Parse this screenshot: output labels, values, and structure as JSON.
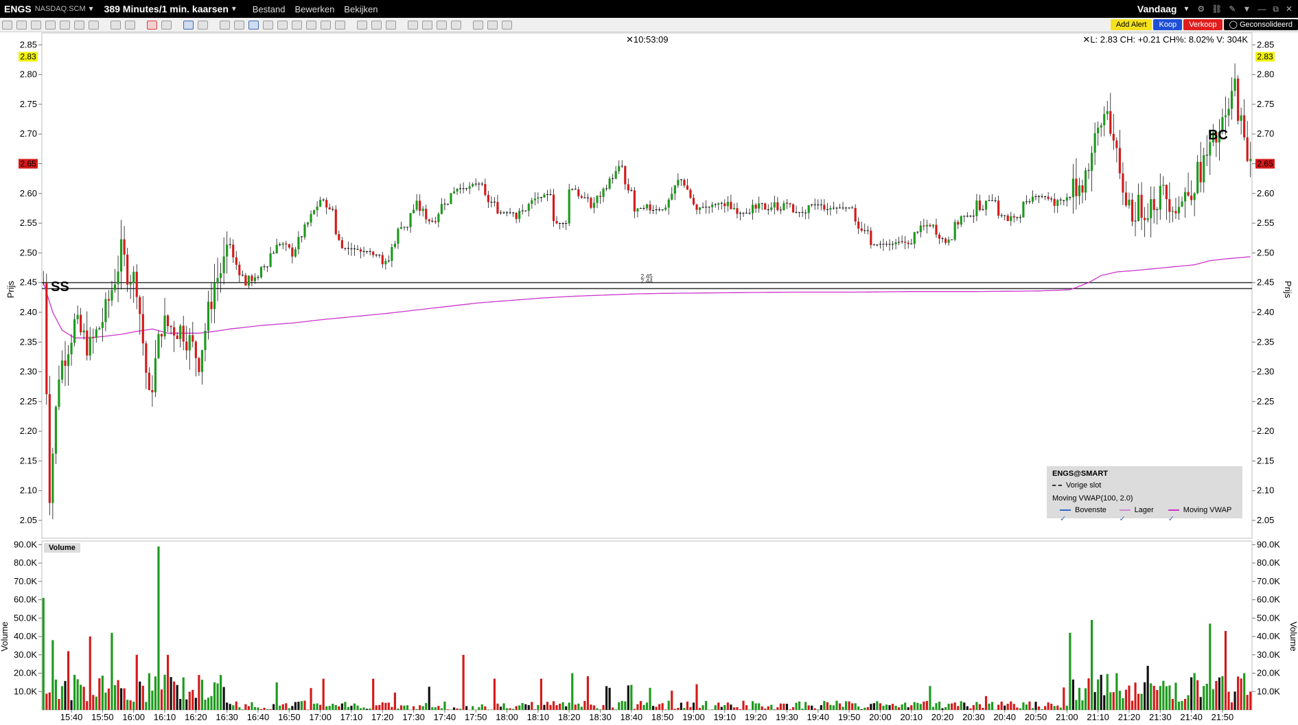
{
  "window": {
    "symbol": "ENGS",
    "exchange": "NASDAQ.SCM",
    "period": "389 Minutes/1 min. kaarsen",
    "menus": [
      "Bestand",
      "Bewerken",
      "Bekijken"
    ],
    "range": "Vandaag"
  },
  "actions": {
    "alert": "Add Alert",
    "buy": "Koop",
    "sell": "Verkoop",
    "consolidated": "Geconsolideerd"
  },
  "header": {
    "time": "10:53:09",
    "quote": "L: 2.83 CH: +0.21 CH%: 8.02% V: 304K"
  },
  "colors": {
    "up": "#1e9a1e",
    "down": "#d41a1a",
    "vwap": "#cc33cc",
    "last_tag": "#f2f20a",
    "price_tag": "#d41a1a"
  },
  "price_tags": {
    "last": "2.83",
    "current": "2.65"
  },
  "markers": {
    "ss": "SS",
    "bc": "BC"
  },
  "hlines": {
    "upper": "2.45",
    "lower": "2.44"
  },
  "legend": {
    "title": "ENGS@SMART",
    "prev_close": "Vorige slot",
    "indicator": "Moving VWAP(100, 2.0)",
    "items": [
      "Bovenste",
      "Lager",
      "Moving VWAP"
    ]
  },
  "volume_label": "Volume",
  "chart_data": {
    "type": "candlestick",
    "price_axis": {
      "label": "Prijs",
      "range": [
        2.02,
        2.87
      ],
      "ticks": [
        "2.05",
        "2.10",
        "2.15",
        "2.20",
        "2.25",
        "2.30",
        "2.35",
        "2.40",
        "2.45",
        "2.50",
        "2.55",
        "2.60",
        "2.65",
        "2.70",
        "2.75",
        "2.80",
        "2.85"
      ]
    },
    "volume_axis": {
      "label": "Volume",
      "range": [
        0,
        92000
      ],
      "ticks": [
        "10.0K",
        "20.0K",
        "30.0K",
        "40.0K",
        "50.0K",
        "60.0K",
        "70.0K",
        "80.0K",
        "90.0K"
      ]
    },
    "time_ticks": [
      "15:40",
      "15:50",
      "16:00",
      "16:10",
      "16:20",
      "16:30",
      "16:40",
      "16:50",
      "17:00",
      "17:10",
      "17:20",
      "17:30",
      "17:40",
      "17:50",
      "18:00",
      "18:10",
      "18:20",
      "18:30",
      "18:40",
      "18:50",
      "19:00",
      "19:10",
      "19:20",
      "19:30",
      "19:40",
      "19:50",
      "20:00",
      "20:10",
      "20:20",
      "20:30",
      "20:40",
      "20:50",
      "21:00",
      "21:10",
      "21:20",
      "21:30",
      "21:40",
      "21:50"
    ],
    "path": [
      {
        "m": 0,
        "p": 2.45
      },
      {
        "m": 2,
        "p": 2.1
      },
      {
        "m": 5,
        "p": 2.3
      },
      {
        "m": 10,
        "p": 2.38
      },
      {
        "m": 15,
        "p": 2.34
      },
      {
        "m": 20,
        "p": 2.4
      },
      {
        "m": 25,
        "p": 2.5
      },
      {
        "m": 27,
        "p": 2.47
      },
      {
        "m": 30,
        "p": 2.45
      },
      {
        "m": 34,
        "p": 2.25
      },
      {
        "m": 38,
        "p": 2.38
      },
      {
        "m": 45,
        "p": 2.37
      },
      {
        "m": 50,
        "p": 2.32
      },
      {
        "m": 55,
        "p": 2.45
      },
      {
        "m": 60,
        "p": 2.5
      },
      {
        "m": 65,
        "p": 2.45
      },
      {
        "m": 70,
        "p": 2.47
      },
      {
        "m": 75,
        "p": 2.52
      },
      {
        "m": 80,
        "p": 2.5
      },
      {
        "m": 85,
        "p": 2.55
      },
      {
        "m": 90,
        "p": 2.6
      },
      {
        "m": 95,
        "p": 2.52
      },
      {
        "m": 100,
        "p": 2.5
      },
      {
        "m": 105,
        "p": 2.5
      },
      {
        "m": 110,
        "p": 2.48
      },
      {
        "m": 115,
        "p": 2.55
      },
      {
        "m": 120,
        "p": 2.58
      },
      {
        "m": 125,
        "p": 2.55
      },
      {
        "m": 130,
        "p": 2.6
      },
      {
        "m": 135,
        "p": 2.62
      },
      {
        "m": 140,
        "p": 2.6
      },
      {
        "m": 145,
        "p": 2.58
      },
      {
        "m": 150,
        "p": 2.55
      },
      {
        "m": 160,
        "p": 2.6
      },
      {
        "m": 165,
        "p": 2.55
      },
      {
        "m": 170,
        "p": 2.62
      },
      {
        "m": 175,
        "p": 2.57
      },
      {
        "m": 185,
        "p": 2.64
      },
      {
        "m": 190,
        "p": 2.57
      },
      {
        "m": 200,
        "p": 2.58
      },
      {
        "m": 205,
        "p": 2.63
      },
      {
        "m": 210,
        "p": 2.57
      },
      {
        "m": 220,
        "p": 2.58
      },
      {
        "m": 225,
        "p": 2.57
      },
      {
        "m": 235,
        "p": 2.58
      },
      {
        "m": 245,
        "p": 2.57
      },
      {
        "m": 250,
        "p": 2.58
      },
      {
        "m": 260,
        "p": 2.57
      },
      {
        "m": 265,
        "p": 2.51
      },
      {
        "m": 275,
        "p": 2.51
      },
      {
        "m": 280,
        "p": 2.53
      },
      {
        "m": 285,
        "p": 2.55
      },
      {
        "m": 290,
        "p": 2.52
      },
      {
        "m": 295,
        "p": 2.56
      },
      {
        "m": 300,
        "p": 2.58
      },
      {
        "m": 305,
        "p": 2.58
      },
      {
        "m": 310,
        "p": 2.55
      },
      {
        "m": 315,
        "p": 2.58
      },
      {
        "m": 320,
        "p": 2.6
      },
      {
        "m": 325,
        "p": 2.58
      },
      {
        "m": 330,
        "p": 2.6
      },
      {
        "m": 334,
        "p": 2.62
      },
      {
        "m": 338,
        "p": 2.68
      },
      {
        "m": 342,
        "p": 2.75
      },
      {
        "m": 346,
        "p": 2.62
      },
      {
        "m": 350,
        "p": 2.57
      },
      {
        "m": 355,
        "p": 2.58
      },
      {
        "m": 360,
        "p": 2.6
      },
      {
        "m": 365,
        "p": 2.58
      },
      {
        "m": 370,
        "p": 2.62
      },
      {
        "m": 375,
        "p": 2.67
      },
      {
        "m": 380,
        "p": 2.72
      },
      {
        "m": 383,
        "p": 2.78
      },
      {
        "m": 386,
        "p": 2.68
      },
      {
        "m": 389,
        "p": 2.65
      }
    ],
    "vwap": [
      {
        "m": 0,
        "p": 2.45
      },
      {
        "m": 3,
        "p": 2.4
      },
      {
        "m": 6,
        "p": 2.37
      },
      {
        "m": 10,
        "p": 2.357
      },
      {
        "m": 15,
        "p": 2.357
      },
      {
        "m": 20,
        "p": 2.36
      },
      {
        "m": 25,
        "p": 2.363
      },
      {
        "m": 30,
        "p": 2.368
      },
      {
        "m": 35,
        "p": 2.372
      },
      {
        "m": 40,
        "p": 2.365
      },
      {
        "m": 50,
        "p": 2.365
      },
      {
        "m": 55,
        "p": 2.368
      },
      {
        "m": 60,
        "p": 2.372
      },
      {
        "m": 70,
        "p": 2.378
      },
      {
        "m": 80,
        "p": 2.382
      },
      {
        "m": 90,
        "p": 2.388
      },
      {
        "m": 100,
        "p": 2.393
      },
      {
        "m": 110,
        "p": 2.398
      },
      {
        "m": 120,
        "p": 2.404
      },
      {
        "m": 130,
        "p": 2.41
      },
      {
        "m": 140,
        "p": 2.416
      },
      {
        "m": 150,
        "p": 2.42
      },
      {
        "m": 160,
        "p": 2.424
      },
      {
        "m": 170,
        "p": 2.427
      },
      {
        "m": 180,
        "p": 2.429
      },
      {
        "m": 190,
        "p": 2.431
      },
      {
        "m": 200,
        "p": 2.432
      },
      {
        "m": 220,
        "p": 2.433
      },
      {
        "m": 240,
        "p": 2.434
      },
      {
        "m": 260,
        "p": 2.434
      },
      {
        "m": 280,
        "p": 2.435
      },
      {
        "m": 300,
        "p": 2.435
      },
      {
        "m": 320,
        "p": 2.436
      },
      {
        "m": 330,
        "p": 2.438
      },
      {
        "m": 336,
        "p": 2.45
      },
      {
        "m": 340,
        "p": 2.462
      },
      {
        "m": 345,
        "p": 2.468
      },
      {
        "m": 350,
        "p": 2.47
      },
      {
        "m": 360,
        "p": 2.475
      },
      {
        "m": 370,
        "p": 2.48
      },
      {
        "m": 375,
        "p": 2.487
      },
      {
        "m": 380,
        "p": 2.49
      },
      {
        "m": 389,
        "p": 2.494
      }
    ],
    "volume_peaks": [
      {
        "m": 0,
        "v": 61000
      },
      {
        "m": 3,
        "v": 38000
      },
      {
        "m": 8,
        "v": 32000
      },
      {
        "m": 15,
        "v": 40000
      },
      {
        "m": 22,
        "v": 42000
      },
      {
        "m": 30,
        "v": 30000
      },
      {
        "m": 37,
        "v": 89000
      },
      {
        "m": 40,
        "v": 30000
      },
      {
        "m": 55,
        "v": 15000
      },
      {
        "m": 75,
        "v": 15000
      },
      {
        "m": 90,
        "v": 17000
      },
      {
        "m": 106,
        "v": 17000
      },
      {
        "m": 135,
        "v": 30000
      },
      {
        "m": 145,
        "v": 17000
      },
      {
        "m": 160,
        "v": 17000
      },
      {
        "m": 170,
        "v": 20000
      },
      {
        "m": 195,
        "v": 12000
      },
      {
        "m": 210,
        "v": 14000
      },
      {
        "m": 255,
        "v": 5000
      },
      {
        "m": 285,
        "v": 13000
      },
      {
        "m": 330,
        "v": 42000
      },
      {
        "m": 337,
        "v": 49000
      },
      {
        "m": 345,
        "v": 20000
      },
      {
        "m": 355,
        "v": 24000
      },
      {
        "m": 370,
        "v": 20000
      },
      {
        "m": 375,
        "v": 47000
      },
      {
        "m": 380,
        "v": 43000
      },
      {
        "m": 386,
        "v": 20000
      }
    ],
    "sessions": 389
  }
}
